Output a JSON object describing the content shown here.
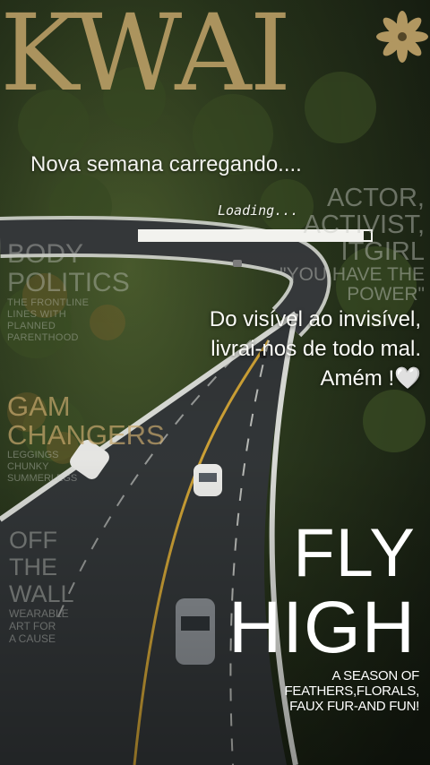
{
  "brand": {
    "logo_text": "KWAI"
  },
  "story": {
    "status_text": "Nova semana carregando....",
    "loading_label": "Loading...",
    "progress": 0.97
  },
  "magazine": {
    "right_cover": [
      "ACTOR,",
      "ACTIVIST,",
      "ITGIRL",
      "\"YOU HAVE THE",
      "POWER\""
    ],
    "left_cover_big": [
      "BODY",
      "POLITICS"
    ],
    "left_cover_small": [
      "THE FRONTLINE",
      "LINES WITH",
      "PLANNED",
      "PARENTHOOD"
    ],
    "gam_big": [
      "GAM",
      "CHANGERS"
    ],
    "gam_small": [
      "LEGGINGS",
      "CHUNKY",
      "SUMMERLEGS"
    ],
    "wall_big": [
      "OFF",
      "THE",
      "WALL"
    ],
    "wall_small": [
      "WEARABLE",
      "ART FOR",
      "A CAUSE"
    ]
  },
  "prayer": {
    "line1": "Do visível ao invisível,",
    "line2": "livrai-nos de todo mal.",
    "line3": "Amém !🤍"
  },
  "headline": {
    "line1": "FLY",
    "line2": "HIGH",
    "tagline1": "A SEASON OF",
    "tagline2": "FEATHERS,FLORALS,",
    "tagline3": "FAUX FUR-AND FUN!"
  },
  "colors": {
    "logo_gold": "#c2a46a",
    "text_white": "#f2f2ee",
    "forest": "#2c3a1e",
    "road": "#3a3d3f",
    "guardrail": "#e9ebe6"
  },
  "icons": {
    "logo_mark": "flower-icon"
  }
}
